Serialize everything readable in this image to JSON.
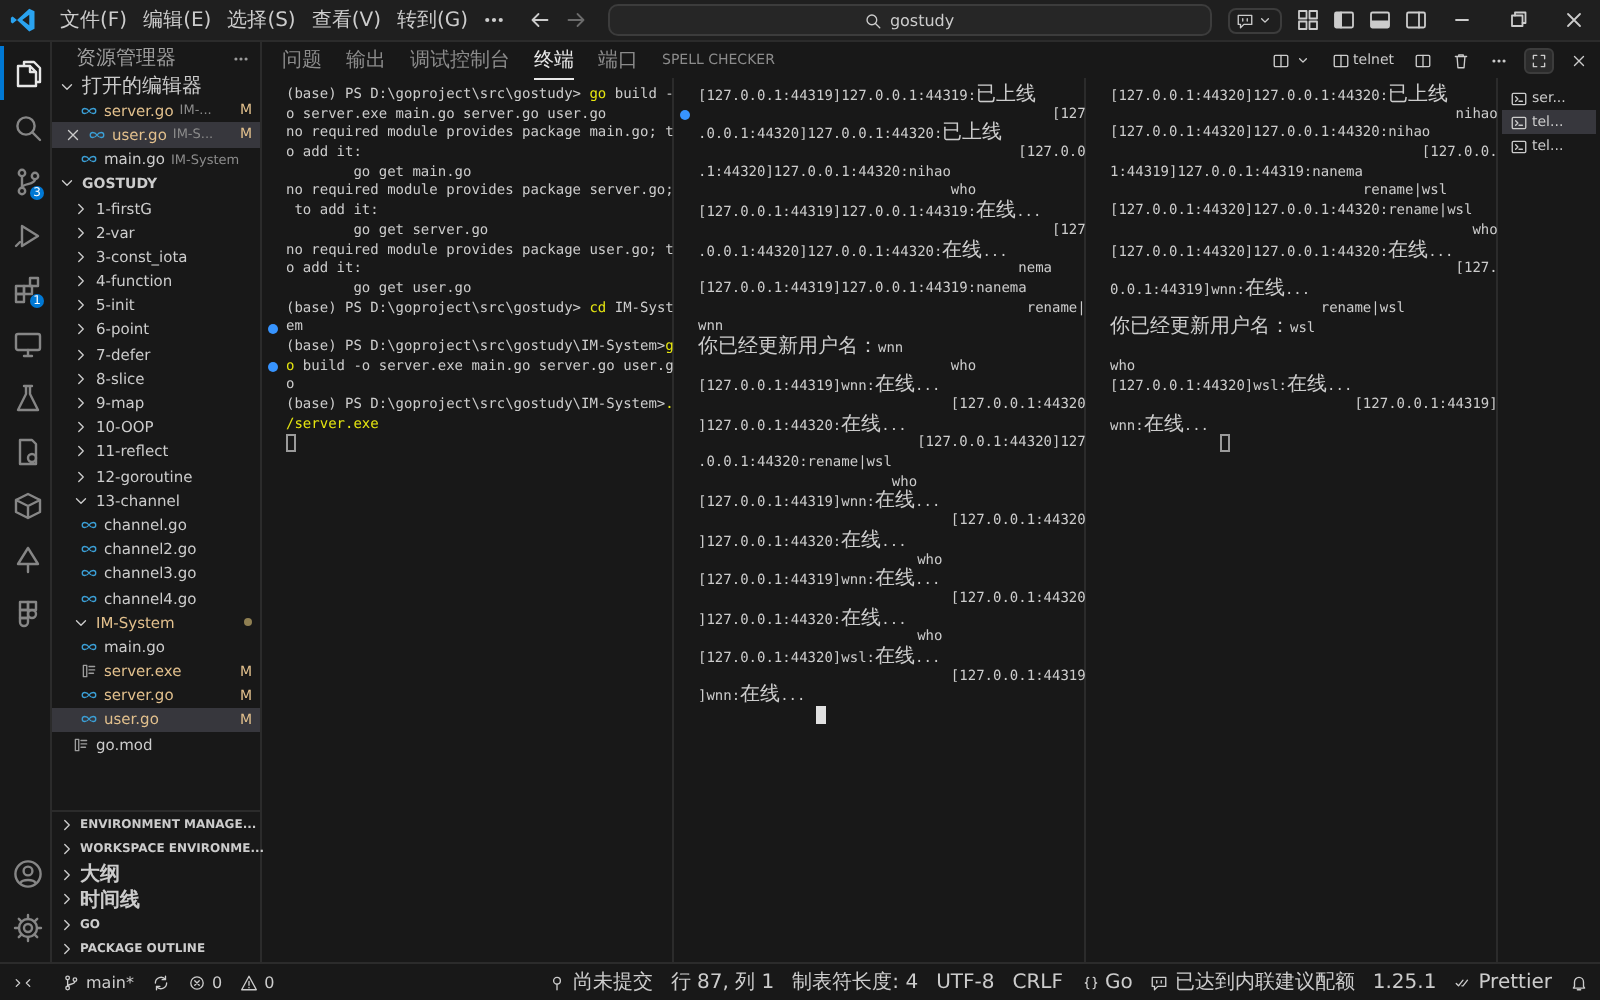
{
  "menu": [
    "文件(F)",
    "编辑(E)",
    "选择(S)",
    "查看(V)",
    "转到(G)"
  ],
  "search": {
    "value": "gostudy"
  },
  "activity_bar": [
    {
      "kind": "files",
      "selected": true
    },
    {
      "kind": "search",
      "selected": false
    },
    {
      "kind": "branch",
      "badge": "3",
      "selected": false
    },
    {
      "kind": "run",
      "selected": false
    },
    {
      "kind": "blocks",
      "badge": "1",
      "selected": false
    },
    {
      "kind": "monitor",
      "selected": false
    },
    {
      "kind": "flask",
      "selected": false
    },
    {
      "kind": "doc",
      "selected": false
    },
    {
      "kind": "cube",
      "selected": false
    },
    {
      "kind": "nodes",
      "selected": false
    },
    {
      "kind": "grid",
      "selected": false
    }
  ],
  "activity_bottom": [
    {
      "kind": "account"
    },
    {
      "kind": "settings"
    }
  ],
  "sidebar": {
    "title": "资源管理器",
    "open_editors": {
      "title": "打开的编辑器",
      "expanded": true,
      "items": [
        {
          "name": "server.go",
          "description": "IM-...",
          "badge": "M",
          "modified": true,
          "selected": false
        },
        {
          "name": "user.go",
          "description": "IM-S...",
          "badge": "M",
          "modified": true,
          "selected": true
        },
        {
          "name": "main.go",
          "description": "IM-System",
          "modified": false,
          "selected": false
        }
      ]
    },
    "workspace": {
      "title": "GOSTUDY",
      "expanded": true,
      "children": [
        {
          "name": "1-firstG",
          "kind": "folder",
          "expanded": false,
          "modified": false,
          "selected": false
        },
        {
          "name": "2-var",
          "kind": "folder",
          "expanded": false,
          "modified": false,
          "selected": false
        },
        {
          "name": "3-const_iota",
          "kind": "folder",
          "expanded": false,
          "modified": false,
          "selected": false
        },
        {
          "name": "4-function",
          "kind": "folder",
          "expanded": false,
          "modified": false,
          "selected": false
        },
        {
          "name": "5-init",
          "kind": "folder",
          "expanded": false,
          "modified": false,
          "selected": false
        },
        {
          "name": "6-point",
          "kind": "folder",
          "expanded": false,
          "modified": false,
          "selected": false
        },
        {
          "name": "7-defer",
          "kind": "folder",
          "expanded": false,
          "modified": false,
          "selected": false
        },
        {
          "name": "8-slice",
          "kind": "folder",
          "expanded": false,
          "modified": false,
          "selected": false
        },
        {
          "name": "9-map",
          "kind": "folder",
          "expanded": false,
          "modified": false,
          "selected": false
        },
        {
          "name": "10-OOP",
          "kind": "folder",
          "expanded": false,
          "modified": false,
          "selected": false
        },
        {
          "name": "11-reflect",
          "kind": "folder",
          "expanded": false,
          "modified": false,
          "selected": false
        },
        {
          "name": "12-goroutine",
          "kind": "folder",
          "expanded": false,
          "modified": false,
          "selected": false
        },
        {
          "name": "13-channel",
          "kind": "folder",
          "expanded": true,
          "modified": false,
          "selected": false,
          "children": [
            {
              "name": "channel.go",
              "kind": "go",
              "modified": false,
              "selected": false
            },
            {
              "name": "channel2.go",
              "kind": "go",
              "modified": false,
              "selected": false
            },
            {
              "name": "channel3.go",
              "kind": "go",
              "modified": false,
              "selected": false
            },
            {
              "name": "channel4.go",
              "kind": "go",
              "modified": false,
              "selected": false
            }
          ]
        },
        {
          "name": "IM-System",
          "kind": "folder",
          "expanded": true,
          "modified": true,
          "selected": false,
          "children": [
            {
              "name": "main.go",
              "kind": "go",
              "modified": false,
              "selected": false
            },
            {
              "name": "server.exe",
              "kind": "exe",
              "badge": "M",
              "modified": true,
              "selected": false
            },
            {
              "name": "server.go",
              "kind": "go",
              "badge": "M",
              "modified": true,
              "selected": false
            },
            {
              "name": "user.go",
              "kind": "go",
              "badge": "M",
              "modified": true,
              "selected": true
            }
          ]
        },
        {
          "name": "go.mod",
          "kind": "exe",
          "modified": false,
          "selected": false
        }
      ]
    },
    "sections": [
      {
        "title": "ENVIRONMENT MANAGE...",
        "expanded": false
      },
      {
        "title": "WORKSPACE ENVIRONME...",
        "expanded": false
      },
      {
        "title": "大纲",
        "expanded": false
      },
      {
        "title": "时间线",
        "expanded": false
      },
      {
        "title": "GO",
        "expanded": false
      },
      {
        "title": "PACKAGE OUTLINE",
        "expanded": false
      }
    ]
  },
  "panel": {
    "tabs": [
      {
        "label": "问题",
        "selected": false
      },
      {
        "label": "输出",
        "selected": false
      },
      {
        "label": "调试控制台",
        "selected": false
      },
      {
        "label": "终端",
        "selected": true
      },
      {
        "label": "端口",
        "selected": false
      },
      {
        "label": "SPELL CHECKER",
        "selected": false
      }
    ],
    "terminal_name": "telnet",
    "terminal_list": [
      {
        "label": "ser...",
        "selected": false
      },
      {
        "label": "tel...",
        "selected": true
      },
      {
        "label": "tel...",
        "selected": false
      }
    ]
  },
  "terminals": [
    {
      "focused": false,
      "lines": [
        {
          "prompt": "(base) PS D:\\goproject\\src\\gostudy> ",
          "command": "go",
          "text": " build -",
          "decorated": false
        },
        {
          "text": "o server.exe main.go server.go user.go",
          "decorated": false
        },
        {
          "text": "no required module provides package main.go; t",
          "decorated": false
        },
        {
          "text": "o add it:",
          "decorated": false
        },
        {
          "text": "        go get main.go",
          "decorated": false
        },
        {
          "text": "no required module provides package server.go;",
          "decorated": false
        },
        {
          "text": " to add it:",
          "decorated": false
        },
        {
          "text": "        go get server.go",
          "decorated": false
        },
        {
          "text": "no required module provides package user.go; t",
          "decorated": false
        },
        {
          "text": "o add it:",
          "decorated": false
        },
        {
          "text": "        go get user.go",
          "decorated": false
        },
        {
          "prompt": "(base) PS D:\\goproject\\src\\gostudy> ",
          "command": "cd",
          "text": " IM-Syst",
          "decorated": false
        },
        {
          "text": "em",
          "decorated": true
        },
        {
          "prompt": "(base) PS D:\\goproject\\src\\gostudy\\IM-System>",
          "command": "g",
          "decorated": false
        },
        {
          "command": "o",
          "text": " build -o server.exe main.go server.go user.g",
          "decorated": true
        },
        {
          "text": "o",
          "decorated": false
        },
        {
          "prompt": "(base) PS D:\\goproject\\src\\gostudy\\IM-System>",
          "command": ".",
          "decorated": false
        },
        {
          "command": "/server.exe",
          "decorated": false
        }
      ]
    },
    {
      "focused": true,
      "lines": [
        {
          "text": "[127.0.0.1:44319]127.0.0.1:44319:已上线",
          "decorated": false
        },
        {
          "text": "                                          [127",
          "decorated": true
        },
        {
          "text": ".0.0.1:44320]127.0.0.1:44320:已上线",
          "decorated": false
        },
        {
          "text": "                                      [127.0.0",
          "decorated": false
        },
        {
          "text": ".1:44320]127.0.0.1:44320:nihao",
          "decorated": false
        },
        {
          "text": "                              who",
          "decorated": false
        },
        {
          "text": "[127.0.0.1:44319]127.0.0.1:44319:在线...",
          "decorated": false
        },
        {
          "text": "                                          [127",
          "decorated": false
        },
        {
          "text": ".0.0.1:44320]127.0.0.1:44320:在线...",
          "decorated": false
        },
        {
          "text": "                                      nema",
          "decorated": false
        },
        {
          "text": "[127.0.0.1:44319]127.0.0.1:44319:nanema",
          "decorated": false
        },
        {
          "text": "                                       rename|",
          "decorated": false
        },
        {
          "text": "wnn",
          "decorated": false
        },
        {
          "text": "你已经更新用户名：wnn",
          "decorated": false
        },
        {
          "text": "                              who",
          "decorated": false
        },
        {
          "text": "[127.0.0.1:44319]wnn:在线...",
          "decorated": false
        },
        {
          "text": "                              [127.0.0.1:44320",
          "decorated": false
        },
        {
          "text": "]127.0.0.1:44320:在线...",
          "decorated": false
        },
        {
          "text": "                          [127.0.0.1:44320]127",
          "decorated": false
        },
        {
          "text": ".0.0.1:44320:rename|wsl",
          "decorated": false
        },
        {
          "text": "                       who",
          "decorated": false
        },
        {
          "text": "[127.0.0.1:44319]wnn:在线...",
          "decorated": false
        },
        {
          "text": "                              [127.0.0.1:44320",
          "decorated": false
        },
        {
          "text": "]127.0.0.1:44320:在线...",
          "decorated": false
        },
        {
          "text": "                          who",
          "decorated": false
        },
        {
          "text": "[127.0.0.1:44319]wnn:在线...",
          "decorated": false
        },
        {
          "text": "                              [127.0.0.1:44320",
          "decorated": false
        },
        {
          "text": "]127.0.0.1:44320:在线...",
          "decorated": false
        },
        {
          "text": "                          who",
          "decorated": false
        },
        {
          "text": "[127.0.0.1:44320]wsl:在线...",
          "decorated": false
        },
        {
          "text": "                              [127.0.0.1:44319",
          "decorated": false
        },
        {
          "text": "]wnn:在线...",
          "decorated": false
        }
      ]
    },
    {
      "focused": false,
      "lines": [
        {
          "text": "[127.0.0.1:44320]127.0.0.1:44320:已上线",
          "decorated": false
        },
        {
          "text": "                                         nihao",
          "decorated": false
        },
        {
          "text": "[127.0.0.1:44320]127.0.0.1:44320:nihao",
          "decorated": false
        },
        {
          "text": "                                     [127.0.0.",
          "decorated": false
        },
        {
          "text": "1:44319]127.0.0.1:44319:nanema",
          "decorated": false
        },
        {
          "text": "                              rename|wsl",
          "decorated": false
        },
        {
          "text": "[127.0.0.1:44320]127.0.0.1:44320:rename|wsl",
          "decorated": false
        },
        {
          "text": "                                           who",
          "decorated": false
        },
        {
          "text": "[127.0.0.1:44320]127.0.0.1:44320:在线...",
          "decorated": false
        },
        {
          "text": "                                         [127.",
          "decorated": false
        },
        {
          "text": "0.0.1:44319]wnn:在线...",
          "decorated": false
        },
        {
          "text": "                         rename|wsl",
          "decorated": false
        },
        {
          "text": "你已经更新用户名：wsl",
          "decorated": false
        },
        {
          "decorated": false
        },
        {
          "text": "who",
          "decorated": false
        },
        {
          "text": "[127.0.0.1:44320]wsl:在线...",
          "decorated": false
        },
        {
          "text": "                             [127.0.0.1:44319]",
          "decorated": false
        },
        {
          "text": "wnn:在线...",
          "decorated": false
        }
      ]
    }
  ],
  "status_bar": {
    "left": [
      {
        "kind": "remote"
      },
      {
        "kind": "branch",
        "text": "main*"
      },
      {
        "kind": "sync"
      },
      {
        "kind": "errors",
        "text": "0"
      },
      {
        "kind": "warnings",
        "text": "0"
      }
    ],
    "right": [
      {
        "kind": "pin",
        "text": "尚未提交"
      },
      {
        "kind": "plain",
        "text": "行 87, 列 1"
      },
      {
        "kind": "plain",
        "text": "制表符长度: 4"
      },
      {
        "kind": "plain",
        "text": "UTF-8"
      },
      {
        "kind": "plain",
        "text": "CRLF"
      },
      {
        "kind": "braces",
        "text": "Go"
      },
      {
        "kind": "chat",
        "text": "已达到内联建议配额"
      },
      {
        "kind": "plain",
        "text": "1.25.1"
      },
      {
        "kind": "check",
        "text": "Prettier"
      },
      {
        "kind": "bell"
      }
    ]
  }
}
